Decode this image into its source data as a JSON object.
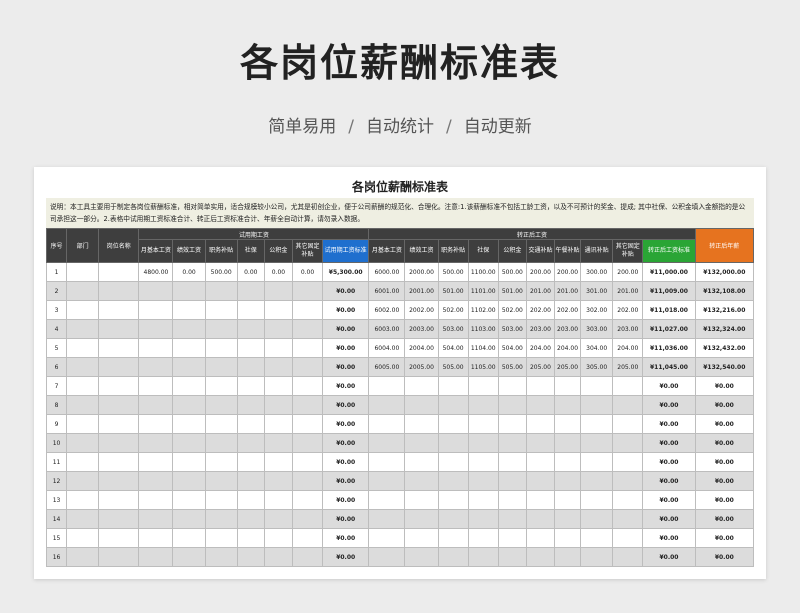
{
  "page": {
    "title": "各岗位薪酬标准表",
    "subtitle": [
      "简单易用",
      "自动统计",
      "自动更新"
    ],
    "separator": "/"
  },
  "sheet": {
    "title": "各岗位薪酬标准表",
    "note": "说明：本工具主要用于制定各岗位薪酬标准，相对简单实用，适合规模较小公司，尤其是初创企业，便于公司薪酬的规范化、合理化。注意:1.该薪酬标准不包括工龄工资，以及不可预计的奖金、提成; 其中社保、公积金填入金额指的是公司承担这一部分。2.表格中试用期工资标准合计、转正后工资标准合计、年薪全自动计算，请勿录入数据。",
    "headers": {
      "seq": "序号",
      "dept": "部门",
      "position": "岗位名称",
      "trial_group": "试用期工资",
      "regular_group": "转正后工资",
      "annual": "转正后年薪",
      "trial_cols": [
        "月基本工资",
        "绩效工资",
        "职务补贴",
        "社保",
        "公积金",
        "其它固定补贴",
        "试用期工资标准"
      ],
      "regular_cols": [
        "月基本工资",
        "绩效工资",
        "职务补贴",
        "社保",
        "公积金",
        "交通补贴",
        "午餐补贴",
        "通讯补贴",
        "其它固定补贴",
        "转正后工资标准"
      ]
    },
    "rows": [
      {
        "n": "1",
        "trial": [
          "4800.00",
          "0.00",
          "500.00",
          "0.00",
          "0.00",
          "0.00"
        ],
        "trial_total": "¥5,300.00",
        "reg": [
          "6000.00",
          "2000.00",
          "500.00",
          "1100.00",
          "500.00",
          "200.00",
          "200.00",
          "300.00",
          "200.00"
        ],
        "reg_total": "¥11,000.00",
        "annual": "¥132,000.00"
      },
      {
        "n": "2",
        "trial": [
          "",
          "",
          "",
          "",
          "",
          ""
        ],
        "trial_total": "¥0.00",
        "reg": [
          "6001.00",
          "2001.00",
          "501.00",
          "1101.00",
          "501.00",
          "201.00",
          "201.00",
          "301.00",
          "201.00"
        ],
        "reg_total": "¥11,009.00",
        "annual": "¥132,108.00"
      },
      {
        "n": "3",
        "trial": [
          "",
          "",
          "",
          "",
          "",
          ""
        ],
        "trial_total": "¥0.00",
        "reg": [
          "6002.00",
          "2002.00",
          "502.00",
          "1102.00",
          "502.00",
          "202.00",
          "202.00",
          "302.00",
          "202.00"
        ],
        "reg_total": "¥11,018.00",
        "annual": "¥132,216.00"
      },
      {
        "n": "4",
        "trial": [
          "",
          "",
          "",
          "",
          "",
          ""
        ],
        "trial_total": "¥0.00",
        "reg": [
          "6003.00",
          "2003.00",
          "503.00",
          "1103.00",
          "503.00",
          "203.00",
          "203.00",
          "303.00",
          "203.00"
        ],
        "reg_total": "¥11,027.00",
        "annual": "¥132,324.00"
      },
      {
        "n": "5",
        "trial": [
          "",
          "",
          "",
          "",
          "",
          ""
        ],
        "trial_total": "¥0.00",
        "reg": [
          "6004.00",
          "2004.00",
          "504.00",
          "1104.00",
          "504.00",
          "204.00",
          "204.00",
          "304.00",
          "204.00"
        ],
        "reg_total": "¥11,036.00",
        "annual": "¥132,432.00"
      },
      {
        "n": "6",
        "trial": [
          "",
          "",
          "",
          "",
          "",
          ""
        ],
        "trial_total": "¥0.00",
        "reg": [
          "6005.00",
          "2005.00",
          "505.00",
          "1105.00",
          "505.00",
          "205.00",
          "205.00",
          "305.00",
          "205.00"
        ],
        "reg_total": "¥11,045.00",
        "annual": "¥132,540.00"
      },
      {
        "n": "7",
        "trial": [
          "",
          "",
          "",
          "",
          "",
          ""
        ],
        "trial_total": "¥0.00",
        "reg": [
          "",
          "",
          "",
          "",
          "",
          "",
          "",
          "",
          ""
        ],
        "reg_total": "¥0.00",
        "annual": "¥0.00"
      },
      {
        "n": "8",
        "trial": [
          "",
          "",
          "",
          "",
          "",
          ""
        ],
        "trial_total": "¥0.00",
        "reg": [
          "",
          "",
          "",
          "",
          "",
          "",
          "",
          "",
          ""
        ],
        "reg_total": "¥0.00",
        "annual": "¥0.00"
      },
      {
        "n": "9",
        "trial": [
          "",
          "",
          "",
          "",
          "",
          ""
        ],
        "trial_total": "¥0.00",
        "reg": [
          "",
          "",
          "",
          "",
          "",
          "",
          "",
          "",
          ""
        ],
        "reg_total": "¥0.00",
        "annual": "¥0.00"
      },
      {
        "n": "10",
        "trial": [
          "",
          "",
          "",
          "",
          "",
          ""
        ],
        "trial_total": "¥0.00",
        "reg": [
          "",
          "",
          "",
          "",
          "",
          "",
          "",
          "",
          ""
        ],
        "reg_total": "¥0.00",
        "annual": "¥0.00"
      },
      {
        "n": "11",
        "trial": [
          "",
          "",
          "",
          "",
          "",
          ""
        ],
        "trial_total": "¥0.00",
        "reg": [
          "",
          "",
          "",
          "",
          "",
          "",
          "",
          "",
          ""
        ],
        "reg_total": "¥0.00",
        "annual": "¥0.00"
      },
      {
        "n": "12",
        "trial": [
          "",
          "",
          "",
          "",
          "",
          ""
        ],
        "trial_total": "¥0.00",
        "reg": [
          "",
          "",
          "",
          "",
          "",
          "",
          "",
          "",
          ""
        ],
        "reg_total": "¥0.00",
        "annual": "¥0.00"
      },
      {
        "n": "13",
        "trial": [
          "",
          "",
          "",
          "",
          "",
          ""
        ],
        "trial_total": "¥0.00",
        "reg": [
          "",
          "",
          "",
          "",
          "",
          "",
          "",
          "",
          ""
        ],
        "reg_total": "¥0.00",
        "annual": "¥0.00"
      },
      {
        "n": "14",
        "trial": [
          "",
          "",
          "",
          "",
          "",
          ""
        ],
        "trial_total": "¥0.00",
        "reg": [
          "",
          "",
          "",
          "",
          "",
          "",
          "",
          "",
          ""
        ],
        "reg_total": "¥0.00",
        "annual": "¥0.00"
      },
      {
        "n": "15",
        "trial": [
          "",
          "",
          "",
          "",
          "",
          ""
        ],
        "trial_total": "¥0.00",
        "reg": [
          "",
          "",
          "",
          "",
          "",
          "",
          "",
          "",
          ""
        ],
        "reg_total": "¥0.00",
        "annual": "¥0.00"
      },
      {
        "n": "16",
        "trial": [
          "",
          "",
          "",
          "",
          "",
          ""
        ],
        "trial_total": "¥0.00",
        "reg": [
          "",
          "",
          "",
          "",
          "",
          "",
          "",
          "",
          ""
        ],
        "reg_total": "¥0.00",
        "annual": "¥0.00"
      }
    ]
  }
}
